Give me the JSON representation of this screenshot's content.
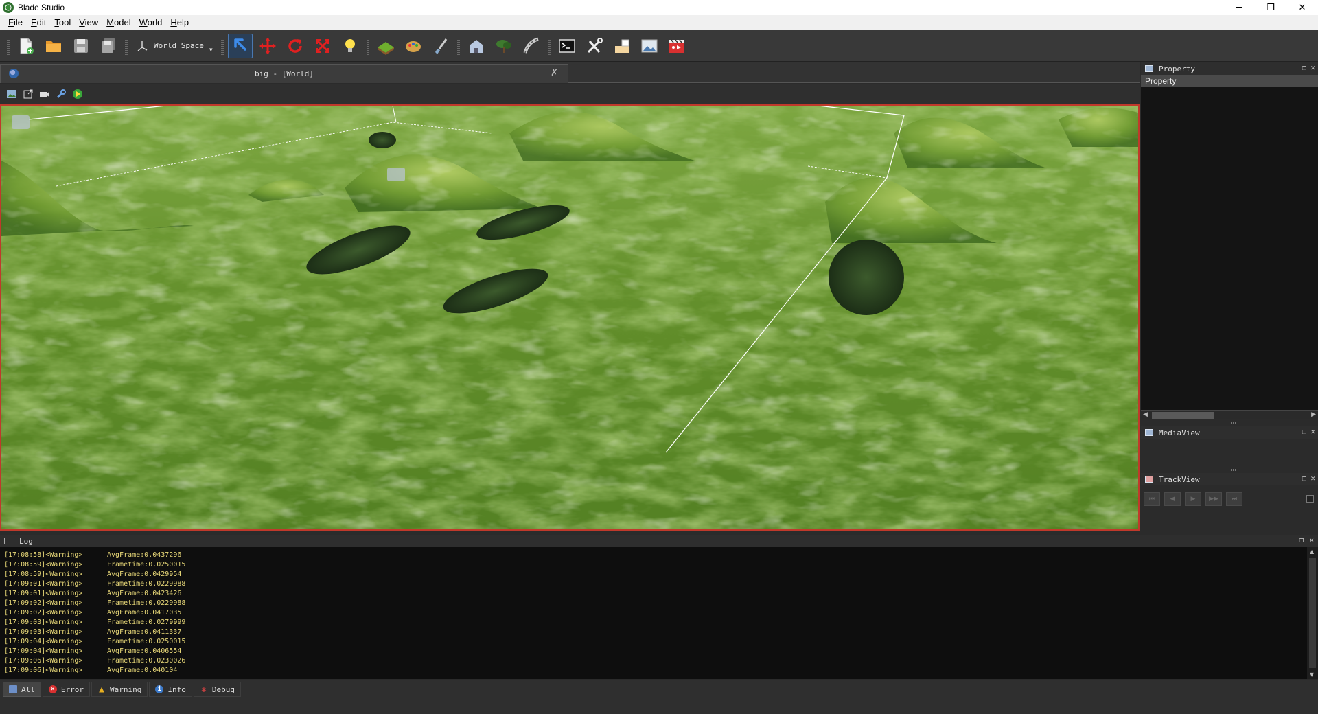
{
  "window": {
    "title": "Blade Studio",
    "controls": [
      "─",
      "❐",
      "✕"
    ]
  },
  "menu": [
    {
      "key": "F",
      "rest": "ile"
    },
    {
      "key": "E",
      "rest": "dit"
    },
    {
      "key": "T",
      "rest": "ool"
    },
    {
      "key": "V",
      "rest": "iew"
    },
    {
      "key": "M",
      "rest": "odel"
    },
    {
      "key": "W",
      "rest": "orld"
    },
    {
      "key": "H",
      "rest": "elp"
    }
  ],
  "toolbar": {
    "space_label": "World Space",
    "icons": [
      "new-file-icon",
      "open-folder-icon",
      "save-icon",
      "save-all-icon",
      "select-arrow-icon",
      "move-icon",
      "rotate-icon",
      "scale-icon",
      "light-bulb-icon",
      "terrain-icon",
      "paint-palette-icon",
      "brush-icon",
      "house-icon",
      "tree-icon",
      "road-icon",
      "console-icon",
      "tools-icon",
      "hand-icon",
      "image-icon",
      "movie-icon"
    ]
  },
  "viewport": {
    "tab_label": "big - [World]",
    "pin_glyph": "✗"
  },
  "property_panel": {
    "title": "Property",
    "sub_title": "Property"
  },
  "media_panel": {
    "title": "MediaView"
  },
  "track_panel": {
    "title": "TrackView",
    "buttons": [
      "⏮",
      "◀",
      "▶",
      "▶▶",
      "⏭"
    ]
  },
  "log": {
    "title": "Log",
    "lines": [
      {
        "time": "[17:08:58]<Warning>",
        "msg": "AvgFrame:0.0437296"
      },
      {
        "time": "[17:08:59]<Warning>",
        "msg": "Frametime:0.0250015"
      },
      {
        "time": "[17:08:59]<Warning>",
        "msg": "AvgFrame:0.0429954"
      },
      {
        "time": "[17:09:01]<Warning>",
        "msg": "Frametime:0.0229988"
      },
      {
        "time": "[17:09:01]<Warning>",
        "msg": "AvgFrame:0.0423426"
      },
      {
        "time": "[17:09:02]<Warning>",
        "msg": "Frametime:0.0229988"
      },
      {
        "time": "[17:09:02]<Warning>",
        "msg": "AvgFrame:0.0417035"
      },
      {
        "time": "[17:09:03]<Warning>",
        "msg": "Frametime:0.0279999"
      },
      {
        "time": "[17:09:03]<Warning>",
        "msg": "AvgFrame:0.0411337"
      },
      {
        "time": "[17:09:04]<Warning>",
        "msg": "Frametime:0.0250015"
      },
      {
        "time": "[17:09:04]<Warning>",
        "msg": "AvgFrame:0.0406554"
      },
      {
        "time": "[17:09:06]<Warning>",
        "msg": "Frametime:0.0230026"
      },
      {
        "time": "[17:09:06]<Warning>",
        "msg": "AvgFrame:0.040104"
      }
    ],
    "tabs": [
      {
        "label": "All",
        "icon": "all-list-icon",
        "color": "#6d8fc7"
      },
      {
        "label": "Error",
        "icon": "error-icon",
        "color": "#d93030"
      },
      {
        "label": "Warning",
        "icon": "warning-icon",
        "color": "#e8b020"
      },
      {
        "label": "Info",
        "icon": "info-icon",
        "color": "#3a78c8"
      },
      {
        "label": "Debug",
        "icon": "debug-icon",
        "color": "#c04040"
      }
    ]
  },
  "colors": {
    "accent_selection": "#c0392b",
    "log_text": "#e8d878",
    "terrain": "#6e9a2e"
  }
}
